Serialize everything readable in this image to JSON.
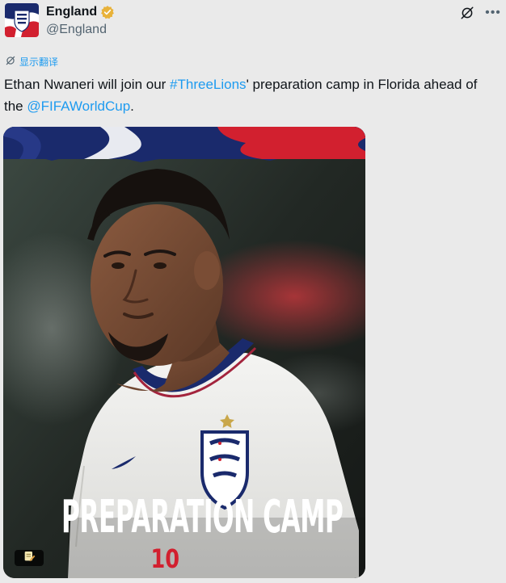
{
  "account": {
    "display_name": "England",
    "handle": "@England"
  },
  "translate_label": "显示翻译",
  "tweet": {
    "part1": "Ethan Nwaneri will join our ",
    "hashtag": "#ThreeLions",
    "part2": "' preparation camp in Florida ahead of the ",
    "mention": "@FIFAWorldCup",
    "part3": "."
  },
  "media": {
    "overlay_text": "PREPARATION CAMP",
    "shirt_number": "10"
  },
  "colors": {
    "accent": "#1d9bf0",
    "verified_gold": "#e8b23a",
    "banner_blue": "#1a2a6c",
    "banner_red": "#d2202f"
  },
  "icons": [
    "verified-badge-icon",
    "grok-icon",
    "more-icon",
    "translate-icon",
    "alt-text-icon"
  ]
}
